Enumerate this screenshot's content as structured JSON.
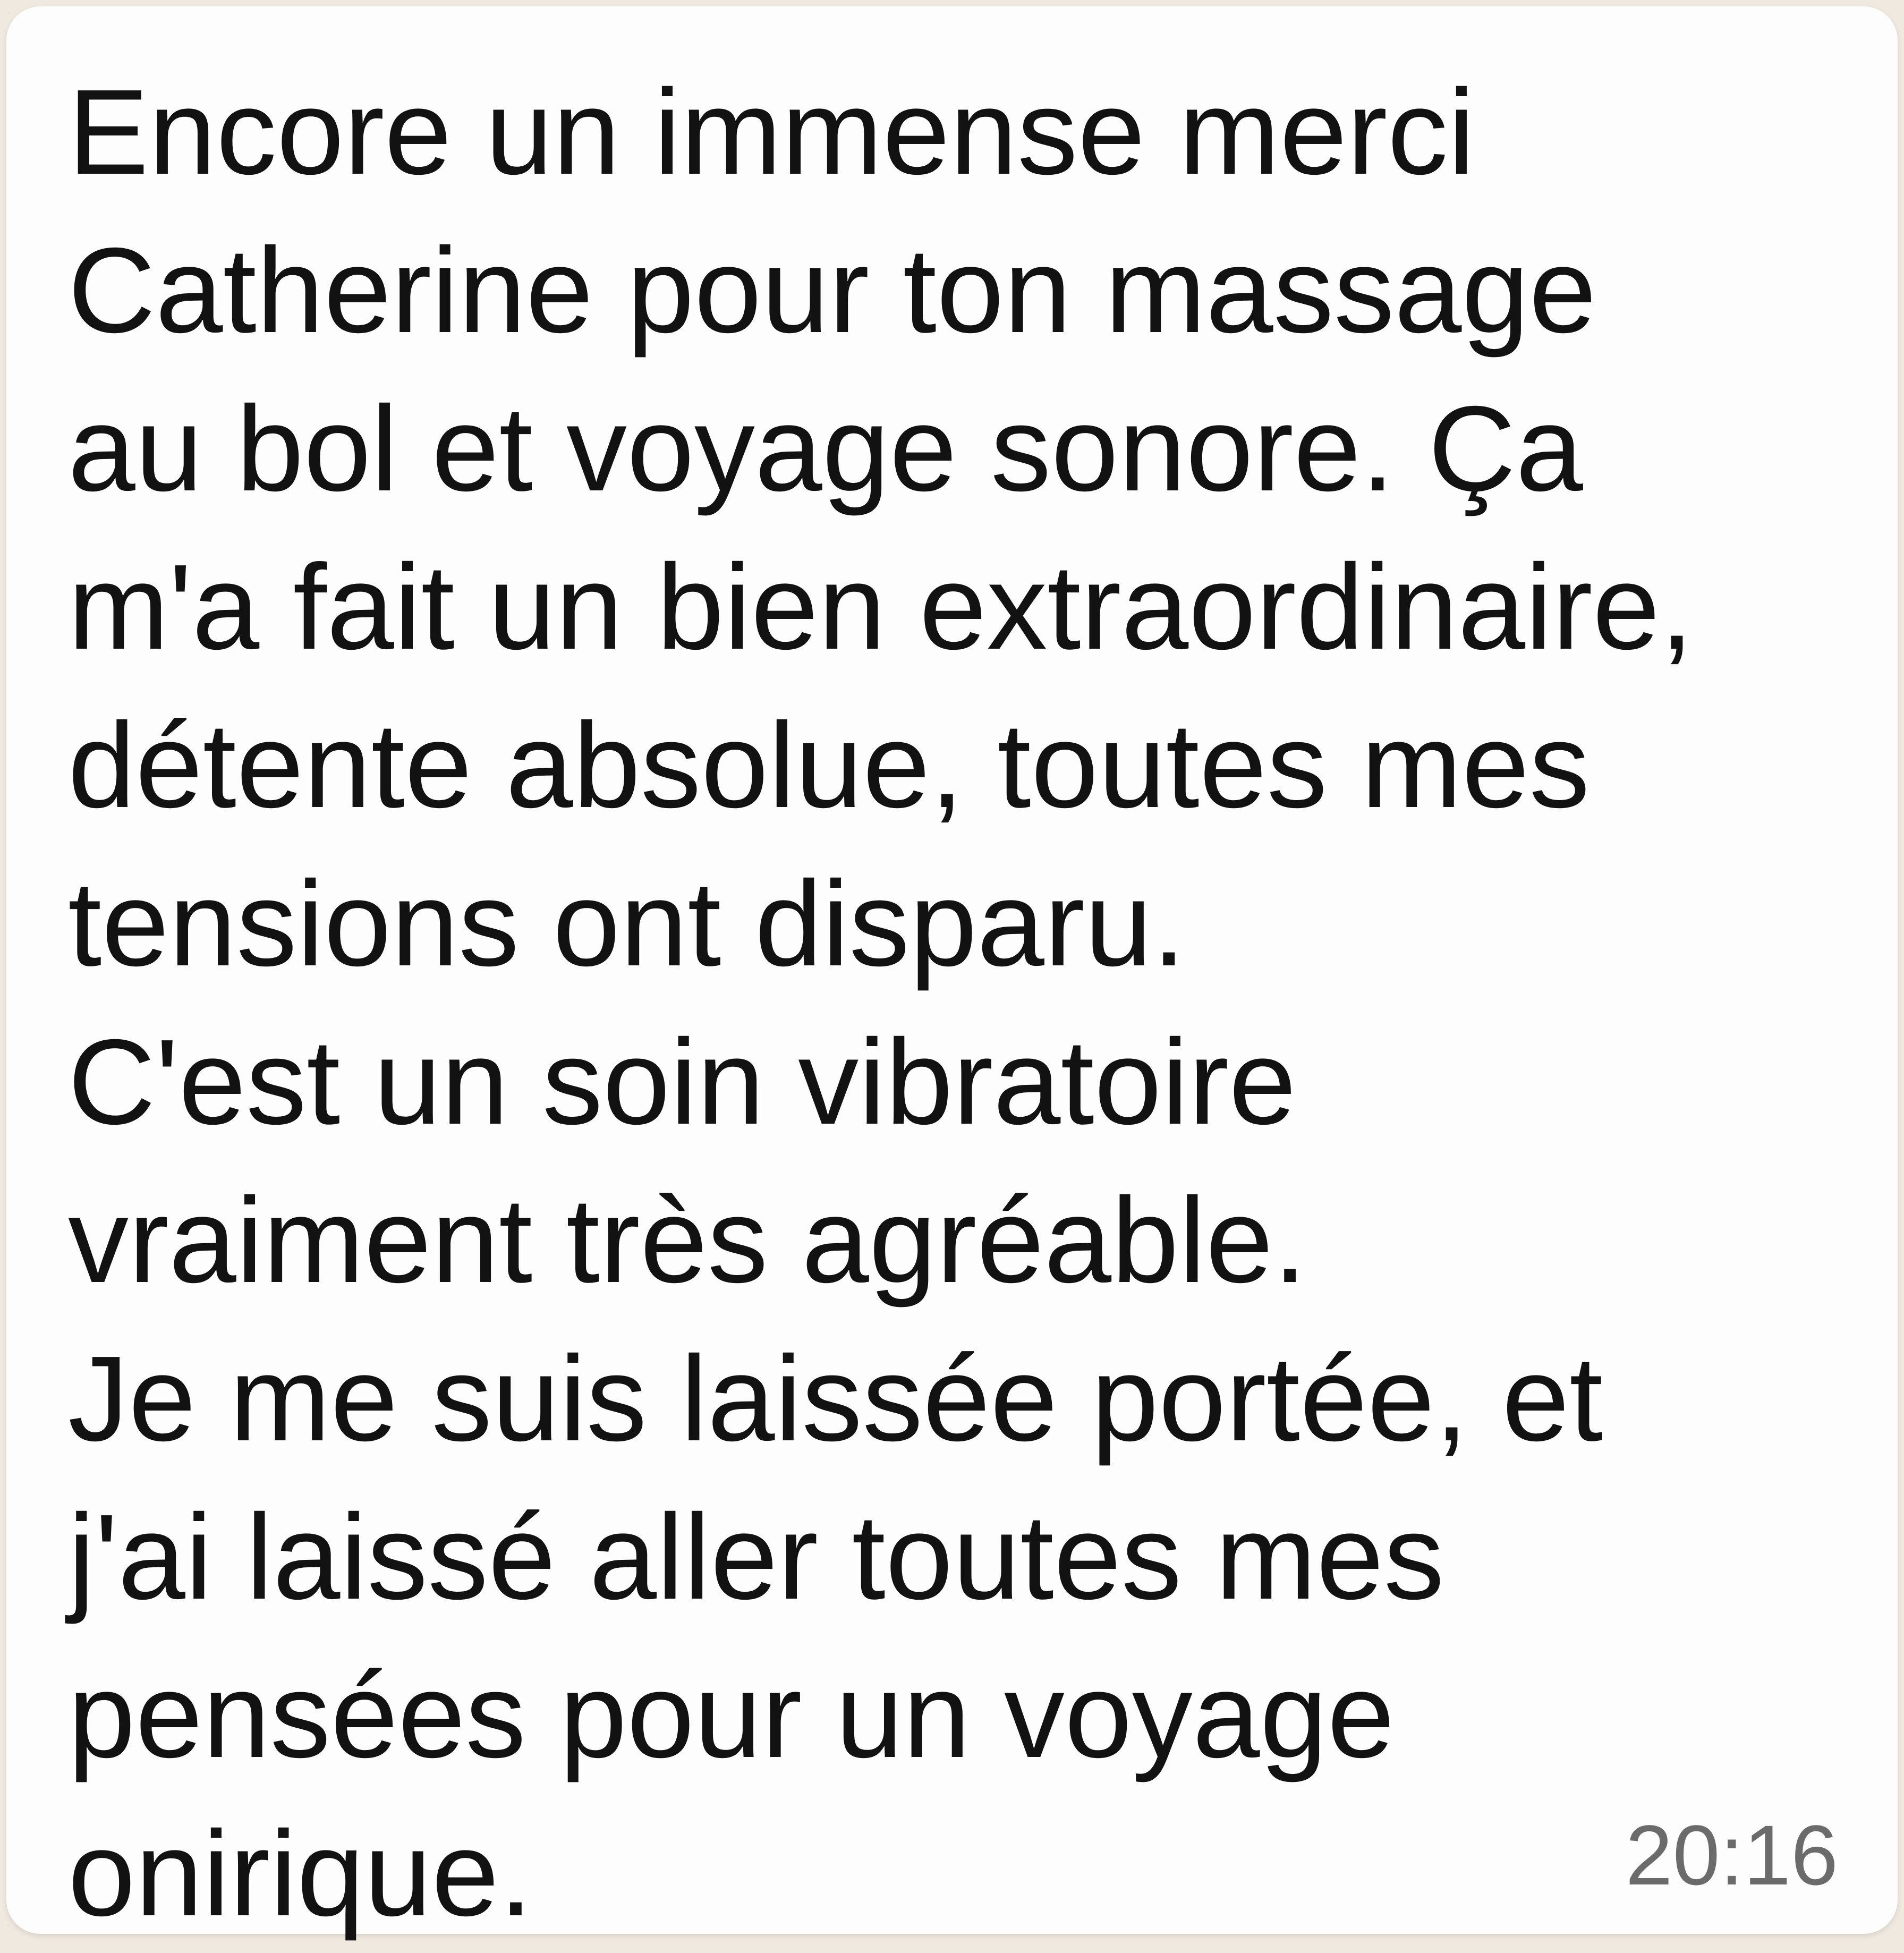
{
  "message": {
    "lines": [
      "Encore un immense merci",
      "Catherine pour ton massage",
      "au bol et voyage sonore. Ça",
      "m'a fait un bien extraordinaire,",
      "détente absolue, toutes mes",
      "tensions ont disparu.",
      "C'est un soin vibratoire",
      "vraiment très agréable.",
      "Je me suis laissée portée, et",
      "j'ai laissé aller toutes mes",
      "pensées pour un voyage",
      "onirique."
    ],
    "time": "20:16"
  },
  "colors": {
    "bubble_background": "#fdfdfd",
    "chat_background": "#efe9df",
    "message_text": "#121212",
    "timestamp_text": "#6b6b6b"
  }
}
